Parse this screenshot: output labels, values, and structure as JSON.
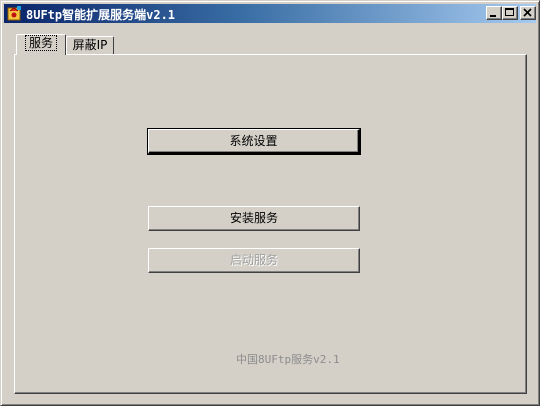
{
  "window": {
    "title": "8UFtp智能扩展服务端v2.1",
    "icon": "app-icon"
  },
  "tabs": [
    {
      "label": "服务",
      "active": true
    },
    {
      "label": "屏蔽IP",
      "active": false
    }
  ],
  "buttons": {
    "settings": "系统设置",
    "install": "安装服务",
    "start": "启动服务"
  },
  "footer": {
    "text": "中国8UFtp服务v2.1"
  }
}
